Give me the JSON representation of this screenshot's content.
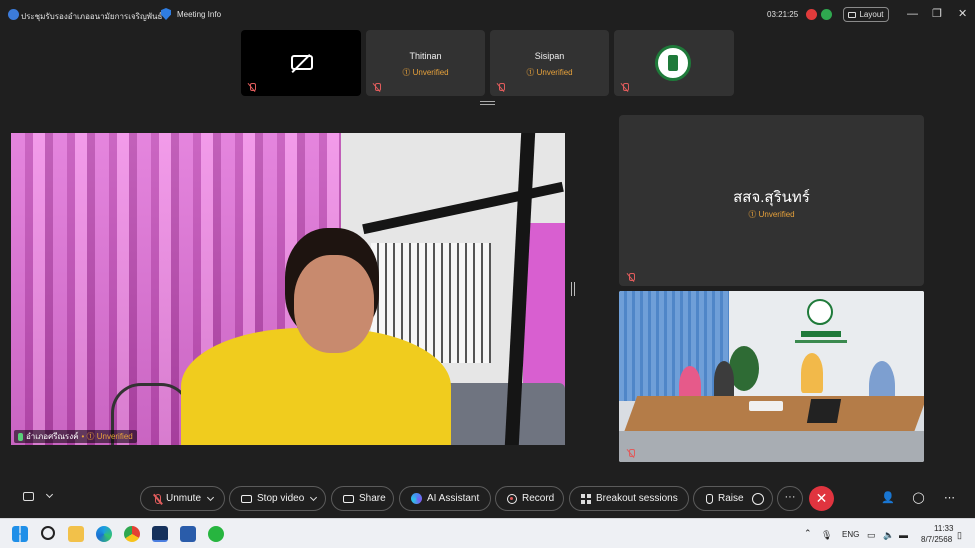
{
  "titlebar": {
    "meeting_title": "ประชุมรับรองอำเภออนามัยการเจริญพันธ์",
    "meeting_info": "Meeting Info",
    "timer": "03:21:25",
    "layout_label": "Layout",
    "window_controls": [
      "—",
      "❐",
      "✕"
    ]
  },
  "thumbnails": [
    {
      "name": "",
      "status": "",
      "video_off": true
    },
    {
      "name": "Thitinan",
      "status": "Unverified"
    },
    {
      "name": "Sisipan",
      "status": "Unverified"
    },
    {
      "name": "",
      "status": "",
      "logo": true
    }
  ],
  "main_video": {
    "name": "อำเภอศรีณรงค์",
    "status": "Unverified"
  },
  "right_tiles": [
    {
      "name": "สสจ.สุรินทร์",
      "status": "Unverified"
    }
  ],
  "controls": {
    "unmute": "Unmute",
    "stop_video": "Stop video",
    "share": "Share",
    "ai_assistant": "AI Assistant",
    "record": "Record",
    "breakout": "Breakout sessions",
    "raise": "Raise",
    "more": "···",
    "leave": "✕"
  },
  "taskbar": {
    "lang": "ENG",
    "time": "11:33",
    "date": "8/7/2568"
  },
  "colors": {
    "unverified": "#e6a13b",
    "leave": "#e0343f",
    "background": "#1f1f1f"
  }
}
